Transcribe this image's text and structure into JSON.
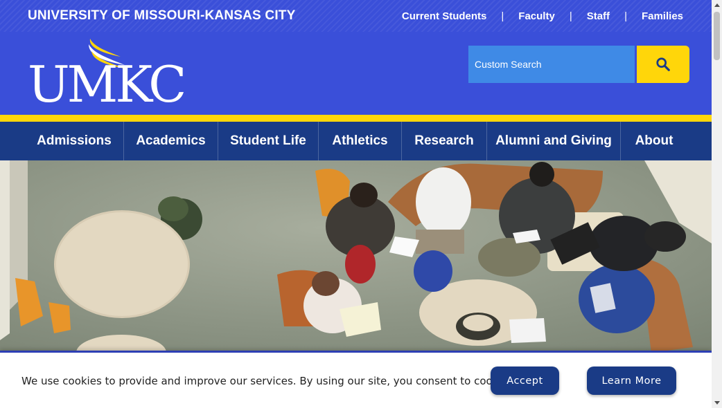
{
  "topbar": {
    "university": "UNIVERSITY OF MISSOURI-KANSAS CITY",
    "links": [
      {
        "label": "Current Students"
      },
      {
        "label": "Faculty"
      },
      {
        "label": "Staff"
      },
      {
        "label": "Families"
      }
    ],
    "separator": "|"
  },
  "header": {
    "logo_text": "UMKC",
    "search": {
      "placeholder": "Custom Search",
      "button_icon": "search-icon"
    }
  },
  "nav": {
    "items": [
      {
        "label": "Admissions"
      },
      {
        "label": "Academics"
      },
      {
        "label": "Student Life"
      },
      {
        "label": "Athletics"
      },
      {
        "label": "Research"
      },
      {
        "label": "Alumni and Giving"
      },
      {
        "label": "About"
      }
    ]
  },
  "cookie": {
    "message": "We use cookies to provide and improve our services. By using our site, you consent to cookies.",
    "accept_label": "Accept",
    "learn_more_label": "Learn More"
  },
  "colors": {
    "brand_blue": "#3a4fd9",
    "nav_blue": "#1a3b86",
    "accent_yellow": "#ffd60a",
    "search_blue": "#3f8ae6"
  }
}
